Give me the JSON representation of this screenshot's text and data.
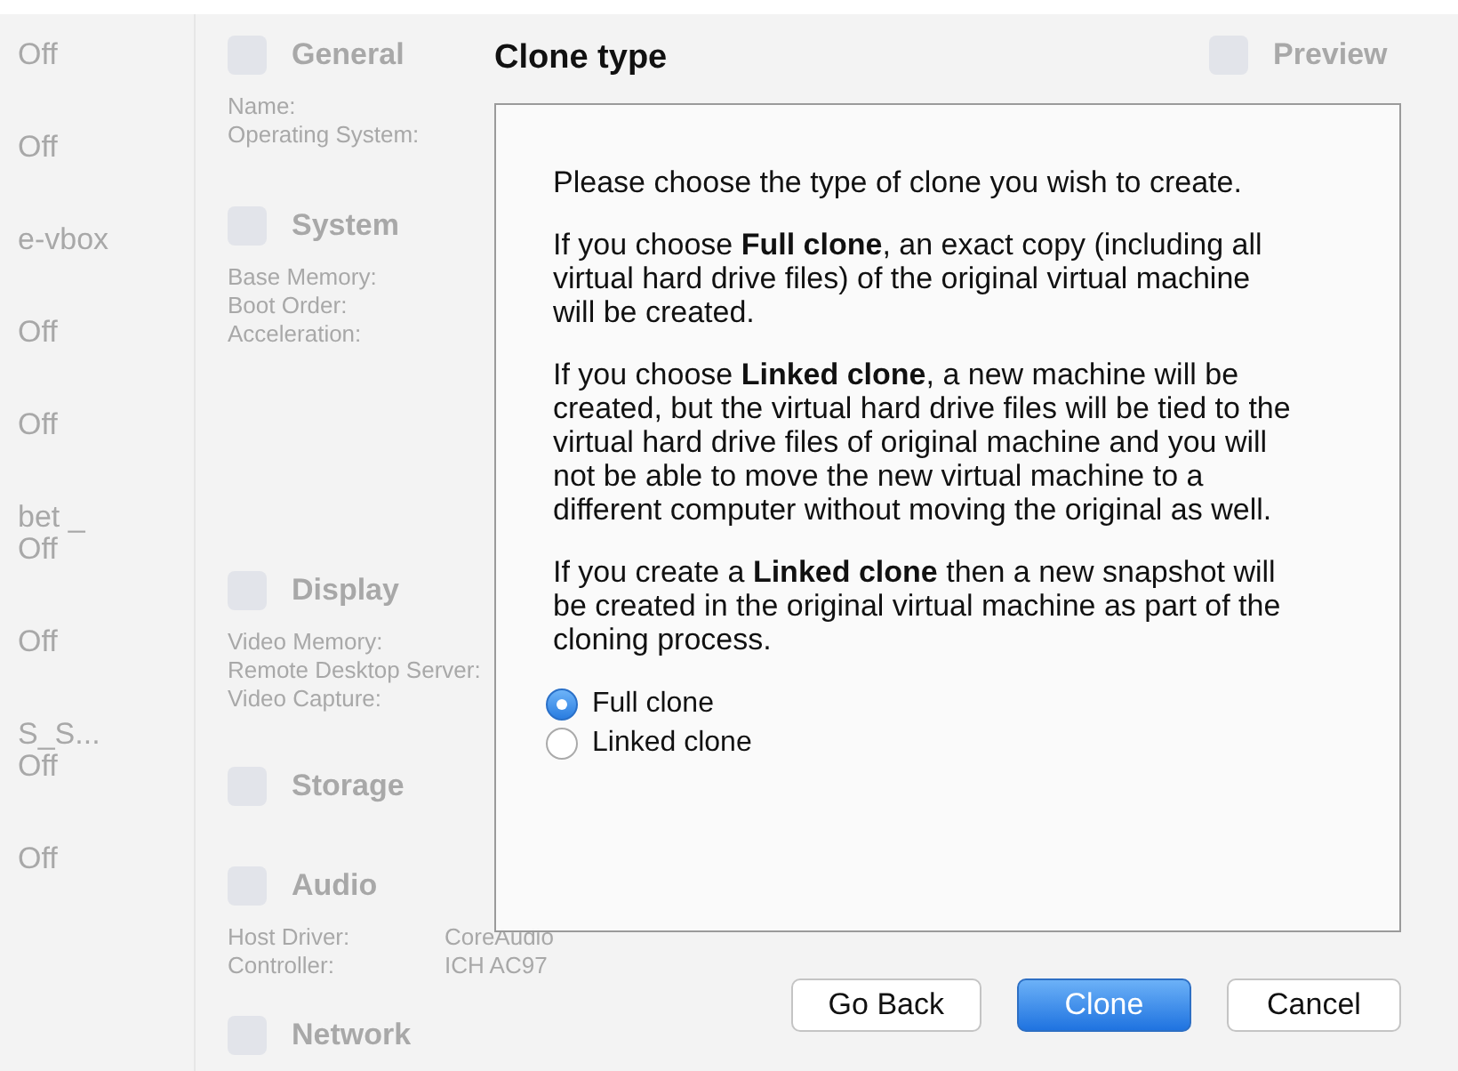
{
  "background": {
    "sidebar_items": [
      {
        "lines": [
          "Off"
        ]
      },
      {
        "lines": [
          "Off"
        ]
      },
      {
        "lines": [
          "e-vbox"
        ]
      },
      {
        "lines": [
          "Off"
        ]
      },
      {
        "lines": [
          "Off"
        ]
      },
      {
        "lines": [
          "bet _",
          "Off"
        ]
      },
      {
        "lines": [
          "Off"
        ]
      },
      {
        "lines": [
          "S_S...",
          "Off"
        ]
      },
      {
        "lines": [
          "Off"
        ]
      }
    ],
    "sections": [
      {
        "title": "General",
        "rows": [
          {
            "label": "Name:"
          },
          {
            "label": "Operating System:"
          }
        ]
      },
      {
        "title": "System",
        "rows": [
          {
            "label": "Base Memory:"
          },
          {
            "label": "Boot Order:"
          },
          {
            "label": "Acceleration:"
          }
        ]
      },
      {
        "title": "Display",
        "rows": [
          {
            "label": "Video Memory:"
          },
          {
            "label": "Remote Desktop Server:"
          },
          {
            "label": "Video Capture:"
          }
        ]
      },
      {
        "title": "Storage"
      },
      {
        "title": "Audio",
        "rows": [
          {
            "label": "Host Driver:",
            "value": "CoreAudio"
          },
          {
            "label": "Controller:",
            "value": "ICH AC97"
          }
        ]
      },
      {
        "title": "Network"
      }
    ],
    "preview": {
      "title": "Preview"
    }
  },
  "dialog": {
    "title": "Clone type",
    "paragraphs": [
      "Please choose the type of clone you wish to create.",
      "If you choose **Full clone**, an exact copy (including all virtual hard drive files) of the original virtual machine will be created.",
      "If you choose **Linked clone**, a new machine will be created, but the virtual hard drive files will be tied to the virtual hard drive files of original machine and you will not be able to move the new virtual machine to a different computer without moving the original as well.",
      "If you create a **Linked clone** then a new snapshot will be created in the original virtual machine as part of the cloning process."
    ],
    "options": [
      {
        "label": "Full clone",
        "selected": true
      },
      {
        "label": "Linked clone",
        "selected": false
      }
    ],
    "buttons": [
      {
        "label": "Go Back",
        "kind": "default"
      },
      {
        "label": "Clone",
        "kind": "primary"
      },
      {
        "label": "Cancel",
        "kind": "default"
      }
    ]
  }
}
